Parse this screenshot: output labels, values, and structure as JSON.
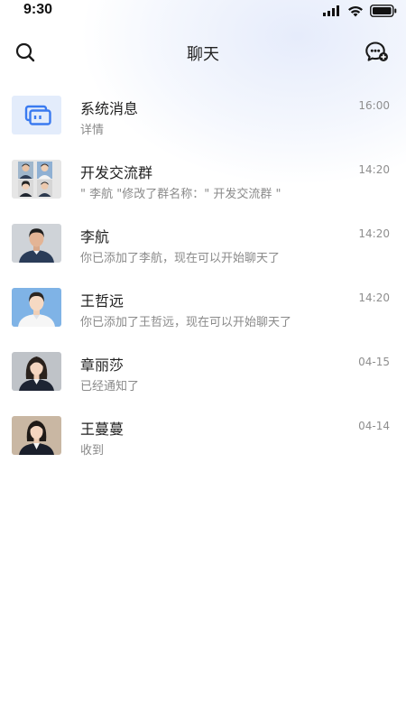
{
  "status_bar": {
    "time": "9:30"
  },
  "header": {
    "title": "聊天",
    "search_icon": "search-icon",
    "add_chat_icon": "chat-plus-icon"
  },
  "chats": [
    {
      "name": "系统消息",
      "time": "16:00",
      "preview": "详情",
      "avatar": "system-message-icon"
    },
    {
      "name": "开发交流群",
      "time": "14:20",
      "preview": "\" 李航 \"修改了群名称：\" 开发交流群 \"",
      "avatar": "group-avatar"
    },
    {
      "name": "李航",
      "time": "14:20",
      "preview": "你已添加了李航，现在可以开始聊天了",
      "avatar": "user-avatar"
    },
    {
      "name": "王哲远",
      "time": "14:20",
      "preview": "你已添加了王哲远，现在可以开始聊天了",
      "avatar": "user-avatar"
    },
    {
      "name": "章丽莎",
      "time": "04-15",
      "preview": "已经通知了",
      "avatar": "user-avatar"
    },
    {
      "name": "王蔓蔓",
      "time": "04-14",
      "preview": "收到",
      "avatar": "user-avatar"
    }
  ],
  "colors": {
    "accent": "#3a7af0",
    "system_avatar_bg": "#e3ecfb"
  }
}
